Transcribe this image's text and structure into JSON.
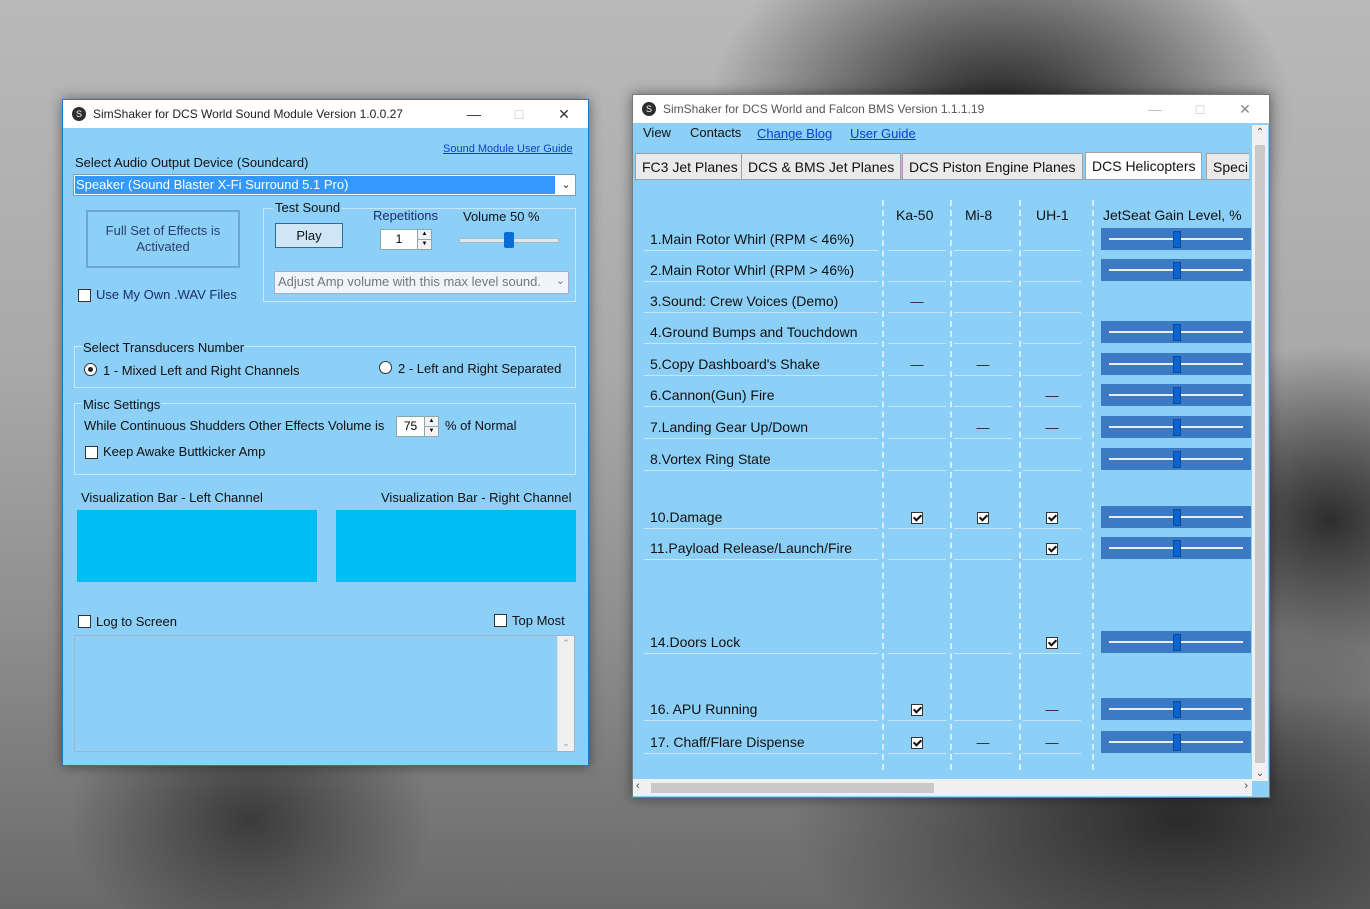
{
  "sound_window": {
    "title": "SimShaker for DCS World Sound Module  Version 1.0.0.27",
    "user_guide_link": "Sound Module User Guide",
    "audio_device_label": "Select Audio Output Device (Soundcard)",
    "audio_device_value": "Speaker (Sound Blaster X-Fi Surround 5.1 Pro)",
    "effects_status": "Full Set of Effects is Activated",
    "test_sound_label": "Test Sound",
    "repetitions_label": "Repetitions",
    "repetitions_value": "1",
    "volume_label": "Volume 50 %",
    "volume_level": 0.5,
    "play_button": "Play",
    "amp_dropdown": "Adjust Amp volume with this max level sound.",
    "use_own_wav": "Use My Own .WAV Files",
    "transducers_title": "Select Transducers Number",
    "transducer_opt1": "1 - Mixed Left and Right Channels",
    "transducer_opt2": "2 - Left and Right Separated",
    "misc_title": "Misc Settings",
    "shudders_label": "While Continuous Shudders Other  Effects Volume is",
    "shudders_value": "75",
    "shudders_suffix": "% of Normal",
    "keep_awake": "Keep Awake Buttkicker Amp",
    "vis_left": "Visualization Bar - Left Channel",
    "vis_right": "Visualization Bar - Right Channel",
    "log_to_screen": "Log to Screen",
    "top_most": "Top Most"
  },
  "main_window": {
    "title": "SimShaker for DCS World and Falcon BMS  Version 1.1.1.19",
    "menu": [
      "View",
      "Contacts",
      "Change Blog",
      "User Guide"
    ],
    "tabs": [
      "FC3 Jet Planes",
      "DCS & BMS Jet Planes",
      "DCS Piston Engine Planes",
      "DCS Helicopters",
      "Speci"
    ],
    "columns": [
      "Ka-50",
      "Mi-8",
      "UH-1",
      "JetSeat Gain Level, %"
    ],
    "dash": "—",
    "rows": [
      {
        "label": "1.Main Rotor Whirl (RPM < 46%)",
        "ka50": "",
        "mi8": "",
        "uh1": "",
        "gain": true
      },
      {
        "label": "2.Main Rotor Whirl (RPM > 46%)",
        "ka50": "",
        "mi8": "",
        "uh1": "",
        "gain": true
      },
      {
        "label": "3.Sound: Crew Voices (Demo)",
        "ka50": "—",
        "mi8": "",
        "uh1": "",
        "gain": false
      },
      {
        "label": "4.Ground Bumps and Touchdown",
        "ka50": "",
        "mi8": "",
        "uh1": "",
        "gain": true
      },
      {
        "label": "5.Copy Dashboard's Shake",
        "ka50": "—",
        "mi8": "—",
        "uh1": "",
        "gain": true
      },
      {
        "label": "6.Cannon(Gun) Fire",
        "ka50": "",
        "mi8": "",
        "uh1": "—",
        "gain": true
      },
      {
        "label": "7.Landing Gear Up/Down",
        "ka50": "",
        "mi8": "—",
        "uh1": "—",
        "gain": true
      },
      {
        "label": "8.Vortex Ring State",
        "ka50": "",
        "mi8": "",
        "uh1": "",
        "gain": true
      },
      {
        "label": "10.Damage",
        "ka50": "check",
        "mi8": "check",
        "uh1": "check",
        "gain": true
      },
      {
        "label": "11.Payload Release/Launch/Fire",
        "ka50": "",
        "mi8": "",
        "uh1": "check",
        "gain": true
      },
      {
        "label": "14.Doors Lock",
        "ka50": "",
        "mi8": "",
        "uh1": "check",
        "gain": true
      },
      {
        "label": "16. APU Running",
        "ka50": "check",
        "mi8": "",
        "uh1": "—",
        "gain": true
      },
      {
        "label": "17. Chaff/Flare Dispense",
        "ka50": "check",
        "mi8": "—",
        "uh1": "—",
        "gain": true
      }
    ]
  }
}
